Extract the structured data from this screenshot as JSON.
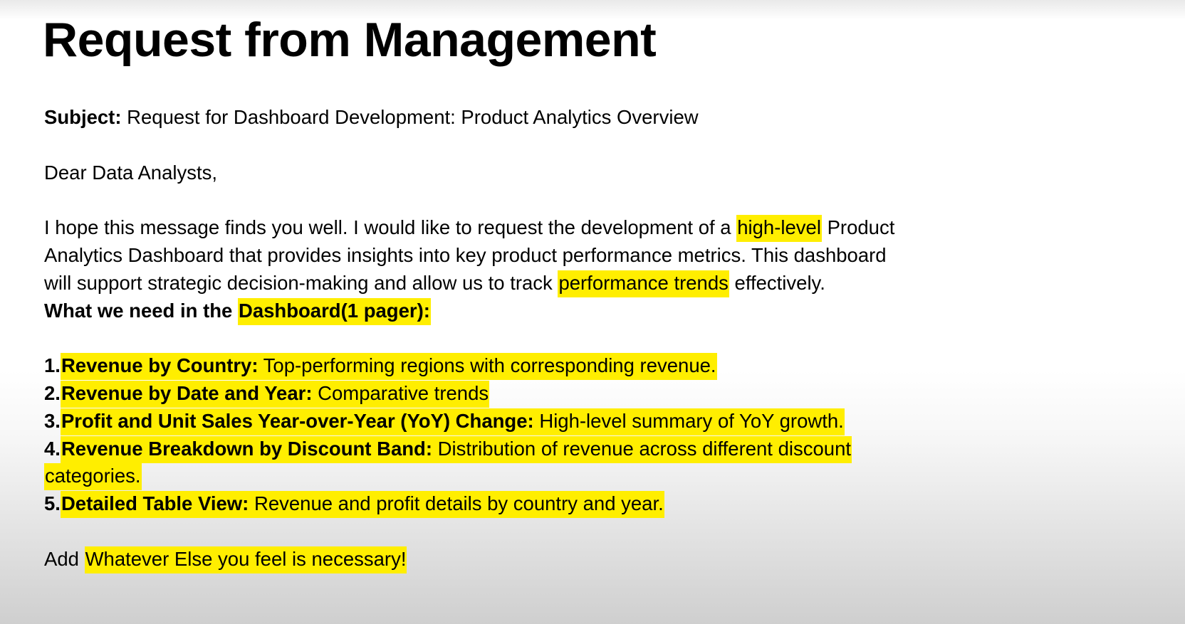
{
  "title": "Request from Management",
  "subject": {
    "label": "Subject:",
    "text": " Request for Dashboard Development: Product Analytics Overview"
  },
  "greeting": "Dear Data Analysts,",
  "intro": {
    "line1_pre": "I hope this message finds you well. I would like to request the development of a ",
    "line1_highlight": "high-level",
    "line1_post": " Product",
    "line2": "Analytics Dashboard that provides insights into key product performance metrics.  This dashboard",
    "line3_pre": "will support strategic decision-making and allow us to track ",
    "line3_highlight": "performance trends",
    "line3_post": " effectively."
  },
  "needs": {
    "pre": "What we need in the ",
    "highlight": "Dashboard(1 pager):"
  },
  "items": [
    {
      "num": "1.",
      "label": "Revenue by Country:",
      "desc": " Top-performing regions with corresponding revenue."
    },
    {
      "num": "2.",
      "label": "Revenue by Date and Year:",
      "desc": " Comparative trends"
    },
    {
      "num": "3.",
      "label": "Profit and Unit Sales Year-over-Year (YoY) Change:",
      "desc": " High-level summary of YoY growth."
    },
    {
      "num": "4.",
      "label": "Revenue Breakdown by Discount Band:",
      "desc": " Distribution of revenue across different discount ",
      "desc_cont": "categories."
    },
    {
      "num": "5.",
      "label": "Detailed Table View:",
      "desc": " Revenue and profit details by country and year."
    }
  ],
  "closing": {
    "pre": "Add ",
    "highlight": "Whatever Else you feel is necessary!"
  },
  "colors": {
    "highlight": "#ffee00",
    "text": "#000000"
  }
}
